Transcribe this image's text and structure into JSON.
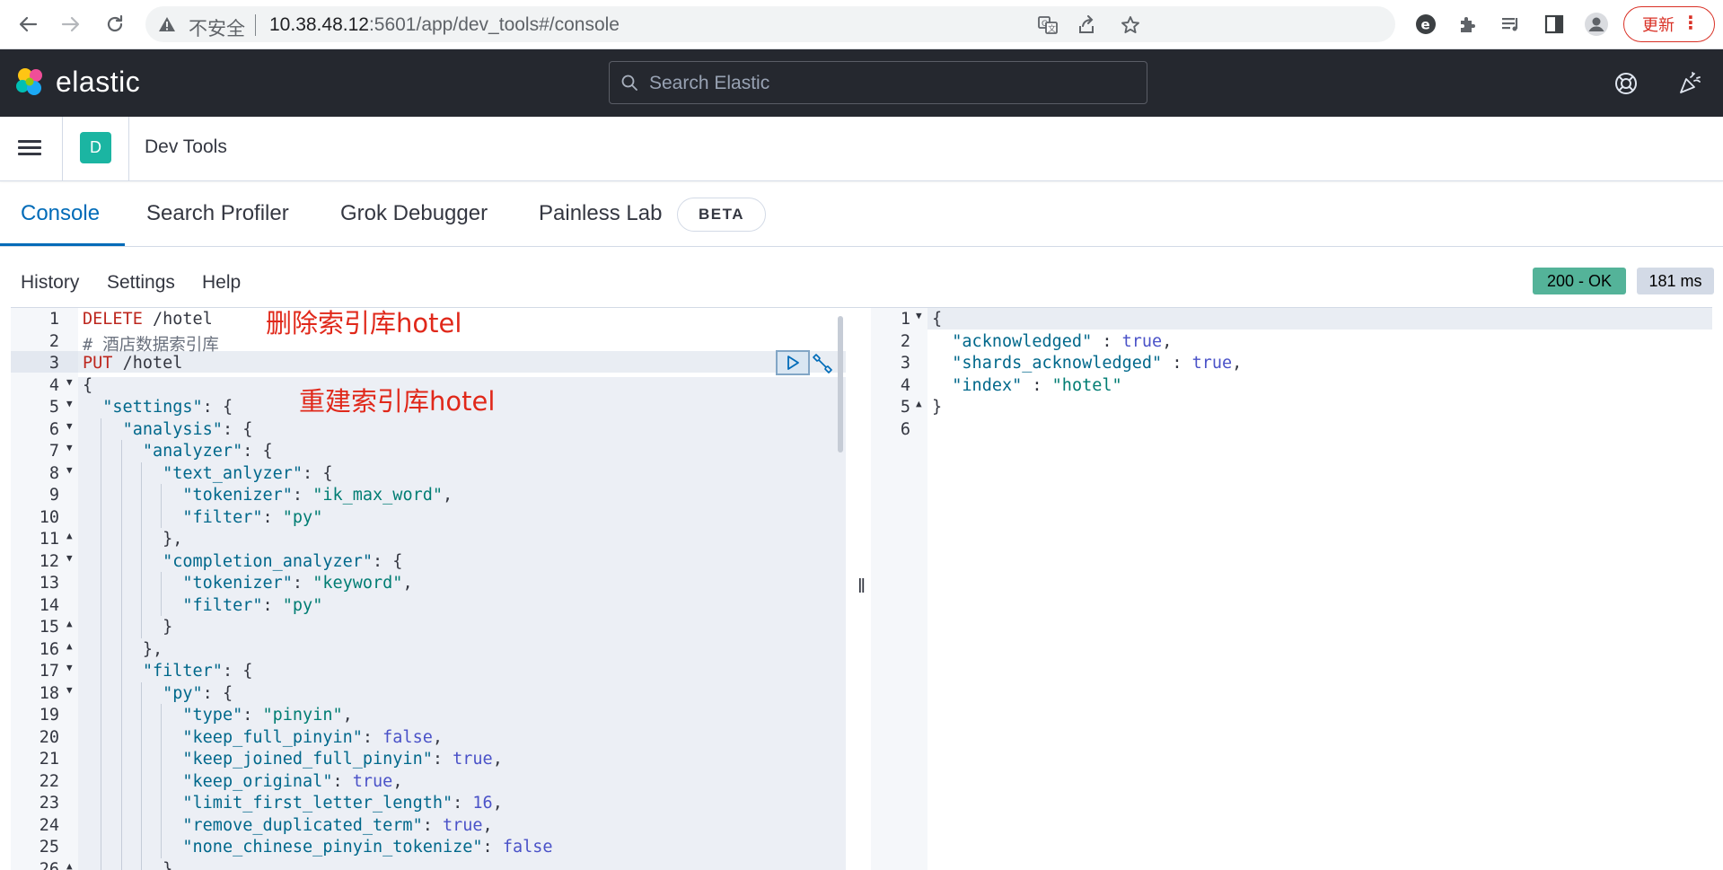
{
  "browser": {
    "insecure_label": "不安全",
    "url_host": "10.38.48.12",
    "url_rest": ":5601/app/dev_tools#/console",
    "update_label": "更新",
    "icons": [
      "back-arrow-icon",
      "forward-arrow-icon",
      "reload-icon",
      "warning-icon",
      "translate-icon",
      "share-icon",
      "star-icon",
      "extension-e-icon",
      "puzzle-icon",
      "reading-list-icon",
      "side-panel-icon",
      "profile-icon",
      "more-vert-icon"
    ]
  },
  "kibana": {
    "logo_text": "elastic",
    "search_placeholder": "Search Elastic",
    "icons": [
      "help-lifebuoy-icon",
      "newsfeed-icon"
    ]
  },
  "appbar": {
    "space_initial": "D",
    "title": "Dev Tools"
  },
  "tabs": [
    {
      "label": "Console",
      "active": true
    },
    {
      "label": "Search Profiler",
      "active": false
    },
    {
      "label": "Grok Debugger",
      "active": false
    },
    {
      "label": "Painless Lab",
      "active": false
    }
  ],
  "beta_label": "BETA",
  "console_menu": {
    "history": "History",
    "settings": "Settings",
    "help": "Help"
  },
  "response_status": {
    "status": "200 - OK",
    "time": "181 ms",
    "status_color": "#54b399"
  },
  "annotations": {
    "delete_note": "删除索引库hotel",
    "rebuild_note": "重建索引库hotel",
    "color": "#e0281a"
  },
  "request_lines": [
    {
      "n": "1",
      "fold": "",
      "text": "DELETE /hotel"
    },
    {
      "n": "2",
      "fold": "",
      "text": "# 酒店数据索引库"
    },
    {
      "n": "3",
      "fold": "",
      "text": "PUT /hotel"
    },
    {
      "n": "4",
      "fold": "▼",
      "text": "{"
    },
    {
      "n": "5",
      "fold": "▼",
      "text": "  \"settings\": {"
    },
    {
      "n": "6",
      "fold": "▼",
      "text": "    \"analysis\": {"
    },
    {
      "n": "7",
      "fold": "▼",
      "text": "      \"analyzer\": {"
    },
    {
      "n": "8",
      "fold": "▼",
      "text": "        \"text_anlyzer\": {"
    },
    {
      "n": "9",
      "fold": "",
      "text": "          \"tokenizer\": \"ik_max_word\","
    },
    {
      "n": "10",
      "fold": "",
      "text": "          \"filter\": \"py\""
    },
    {
      "n": "11",
      "fold": "▲",
      "text": "        },"
    },
    {
      "n": "12",
      "fold": "▼",
      "text": "        \"completion_analyzer\": {"
    },
    {
      "n": "13",
      "fold": "",
      "text": "          \"tokenizer\": \"keyword\","
    },
    {
      "n": "14",
      "fold": "",
      "text": "          \"filter\": \"py\""
    },
    {
      "n": "15",
      "fold": "▲",
      "text": "        }"
    },
    {
      "n": "16",
      "fold": "▲",
      "text": "      },"
    },
    {
      "n": "17",
      "fold": "▼",
      "text": "      \"filter\": {"
    },
    {
      "n": "18",
      "fold": "▼",
      "text": "        \"py\": {"
    },
    {
      "n": "19",
      "fold": "",
      "text": "          \"type\": \"pinyin\","
    },
    {
      "n": "20",
      "fold": "",
      "text": "          \"keep_full_pinyin\": false,"
    },
    {
      "n": "21",
      "fold": "",
      "text": "          \"keep_joined_full_pinyin\": true,"
    },
    {
      "n": "22",
      "fold": "",
      "text": "          \"keep_original\": true,"
    },
    {
      "n": "23",
      "fold": "",
      "text": "          \"limit_first_letter_length\": 16,"
    },
    {
      "n": "24",
      "fold": "",
      "text": "          \"remove_duplicated_term\": true,"
    },
    {
      "n": "25",
      "fold": "",
      "text": "          \"none_chinese_pinyin_tokenize\": false"
    },
    {
      "n": "26",
      "fold": "▲",
      "text": "        }"
    }
  ],
  "response_lines": [
    {
      "n": "1",
      "fold": "▼",
      "text": "{"
    },
    {
      "n": "2",
      "fold": "",
      "text": "  \"acknowledged\" : true,"
    },
    {
      "n": "3",
      "fold": "",
      "text": "  \"shards_acknowledged\" : true,"
    },
    {
      "n": "4",
      "fold": "",
      "text": "  \"index\" : \"hotel\""
    },
    {
      "n": "5",
      "fold": "▲",
      "text": "}"
    },
    {
      "n": "6",
      "fold": "",
      "text": ""
    }
  ],
  "resizer_glyph": "‖"
}
